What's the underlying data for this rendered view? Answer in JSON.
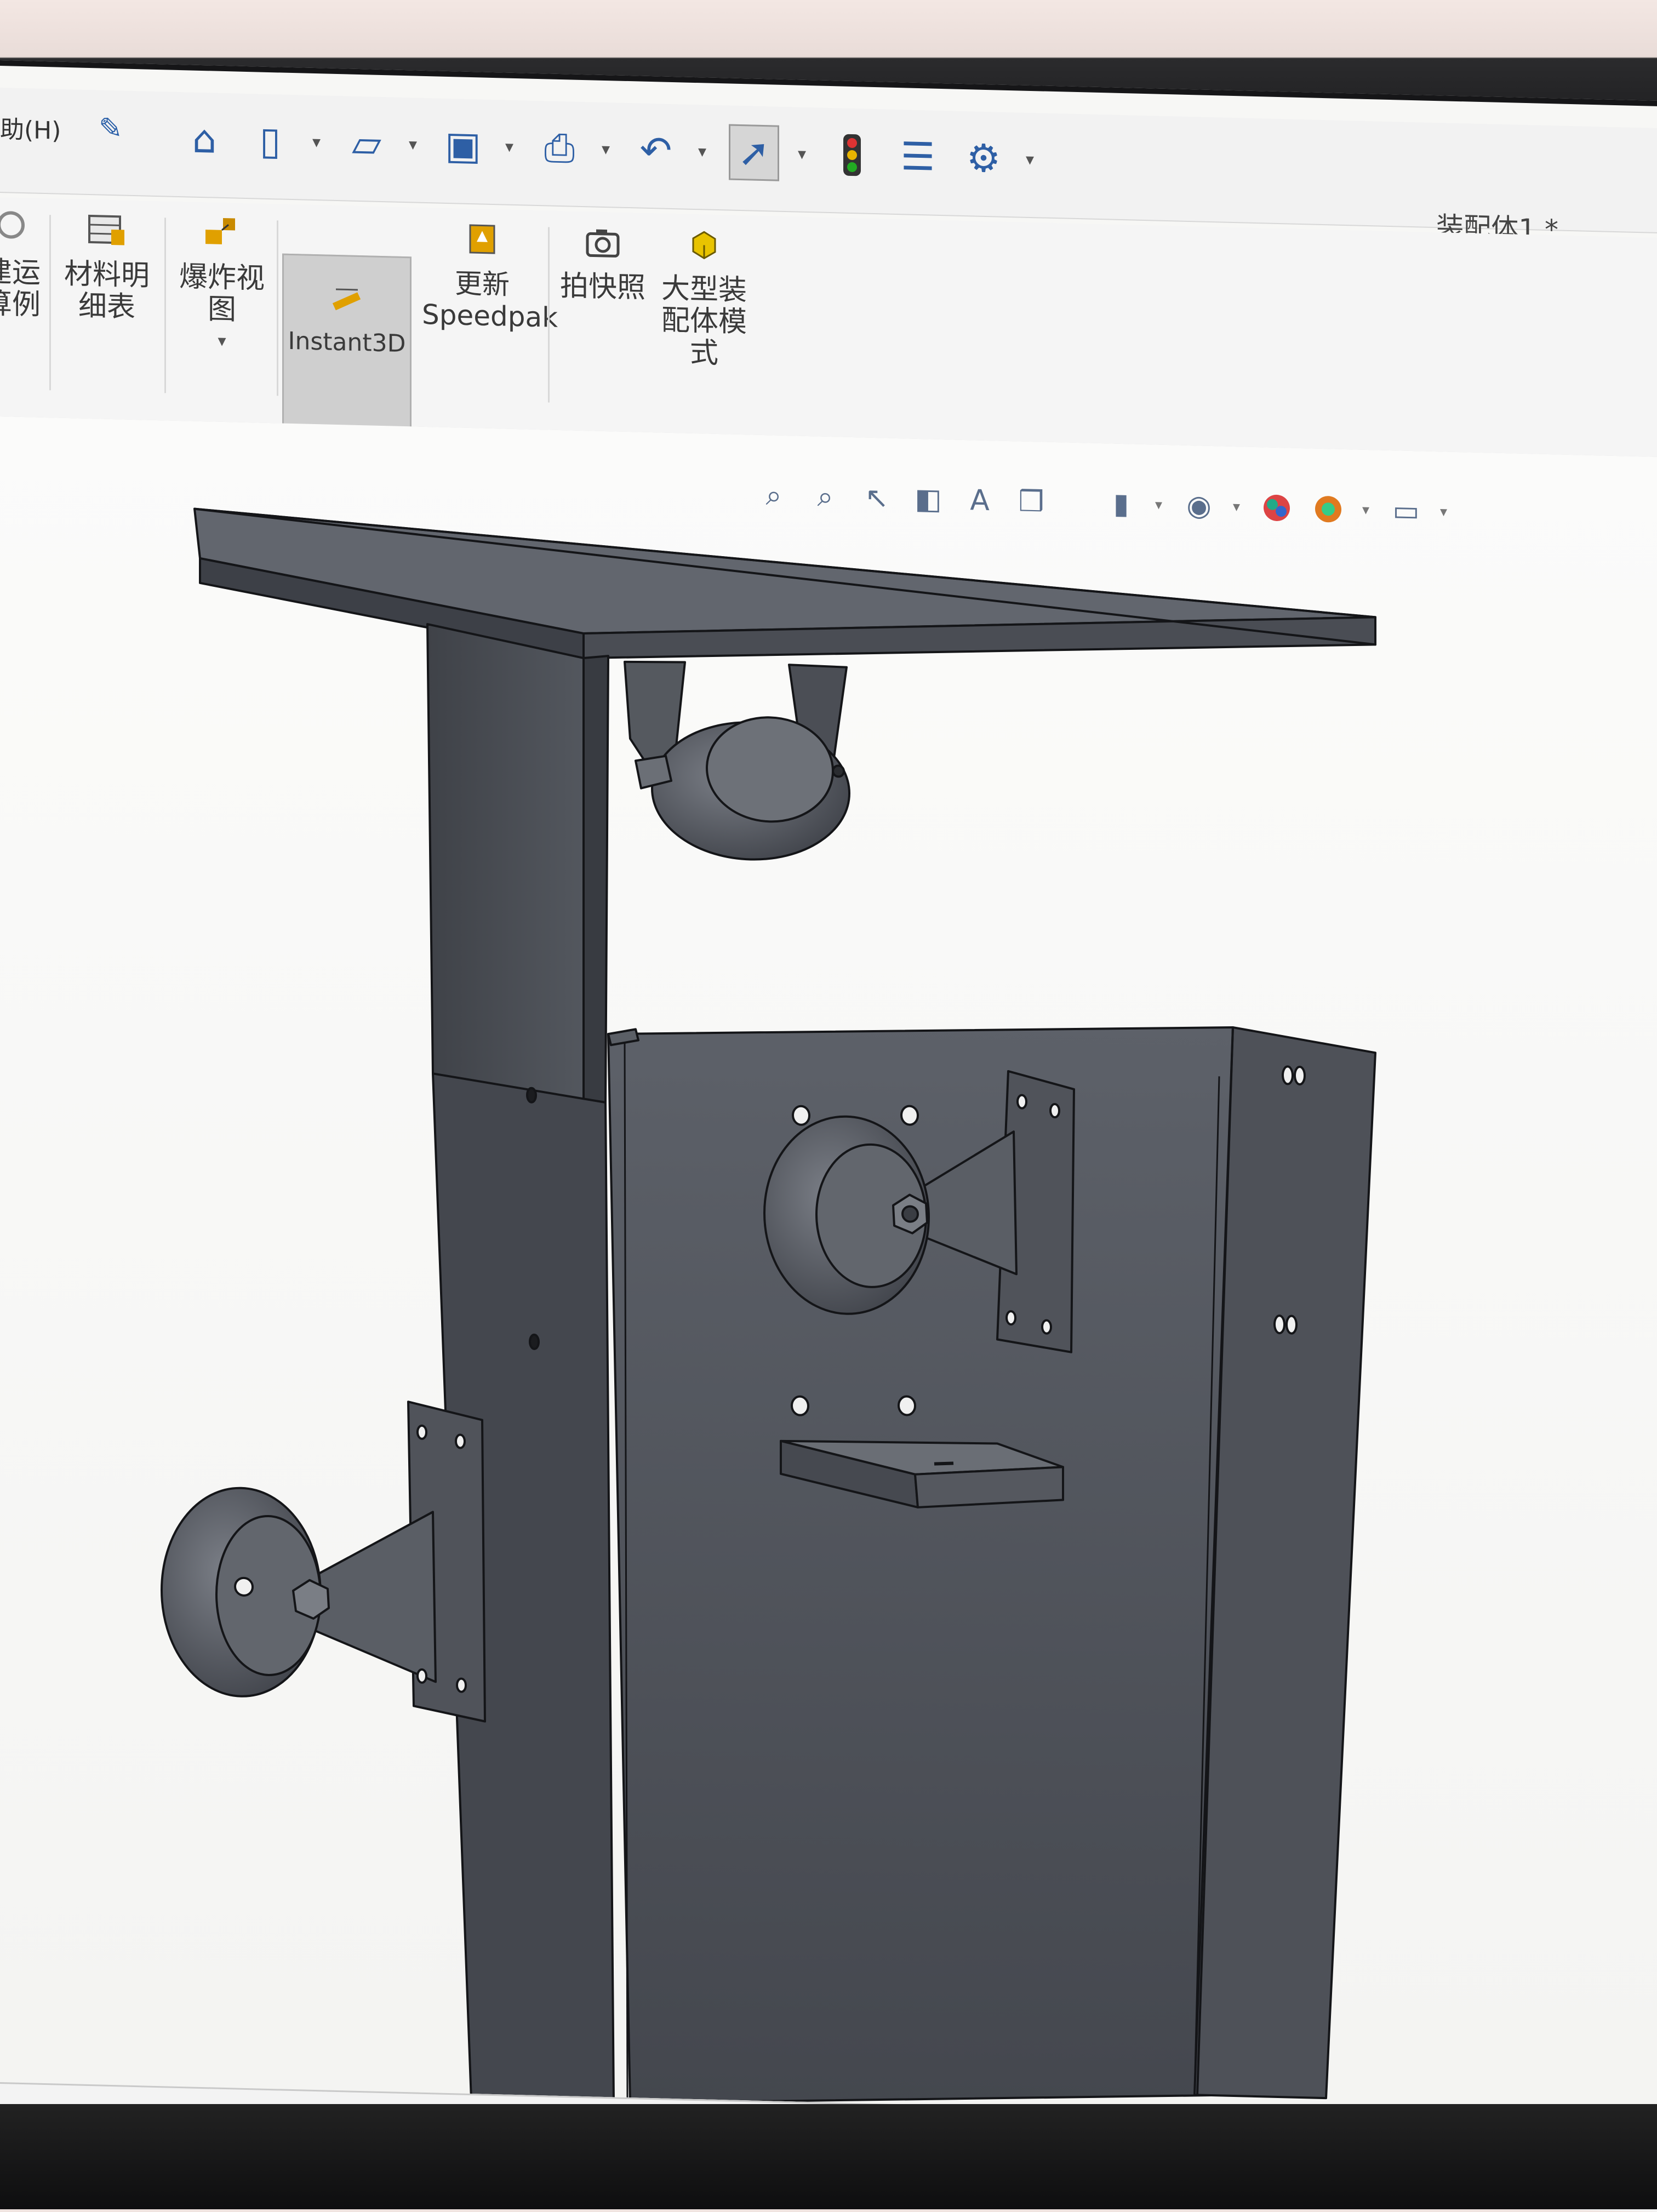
{
  "menu": {
    "help_label": "助(H)"
  },
  "document": {
    "title": "装配体1 *"
  },
  "quick_access": {
    "icons": [
      "home-icon",
      "new-document-icon",
      "open-folder-icon",
      "save-icon",
      "print-icon",
      "undo-icon",
      "select-cursor-icon",
      "traffic-light-icon",
      "options-list-icon",
      "gear-icon"
    ]
  },
  "ribbon": {
    "items": [
      {
        "label": "建运\n算例",
        "icon": "motion-study-icon"
      },
      {
        "label": "材料明\n细表",
        "icon": "bom-icon"
      },
      {
        "label": "爆炸视\n图",
        "icon": "exploded-view-icon"
      },
      {
        "label": "Instant3D",
        "icon": "instant3d-icon"
      },
      {
        "label": "更新\nSpeedpak",
        "icon": "speedpak-icon"
      },
      {
        "label": "拍快照",
        "icon": "camera-icon"
      },
      {
        "label": "大型装\n配体模\n式",
        "icon": "large-assembly-icon"
      }
    ]
  },
  "view_toolbar": {
    "icons": [
      "zoom-to-fit-icon",
      "zoom-area-icon",
      "previous-view-icon",
      "section-view-icon",
      "dynamic-annotation-icon",
      "view-orientation-icon",
      "display-style-icon",
      "hide-show-icon",
      "edit-appearance-icon",
      "scene-icon",
      "view-settings-icon"
    ]
  },
  "colors": {
    "part_face": "#4d5159",
    "part_face_light": "#62666e",
    "part_face_dark": "#3d4047",
    "edge": "#141518",
    "accent": "#2e5fa5"
  }
}
